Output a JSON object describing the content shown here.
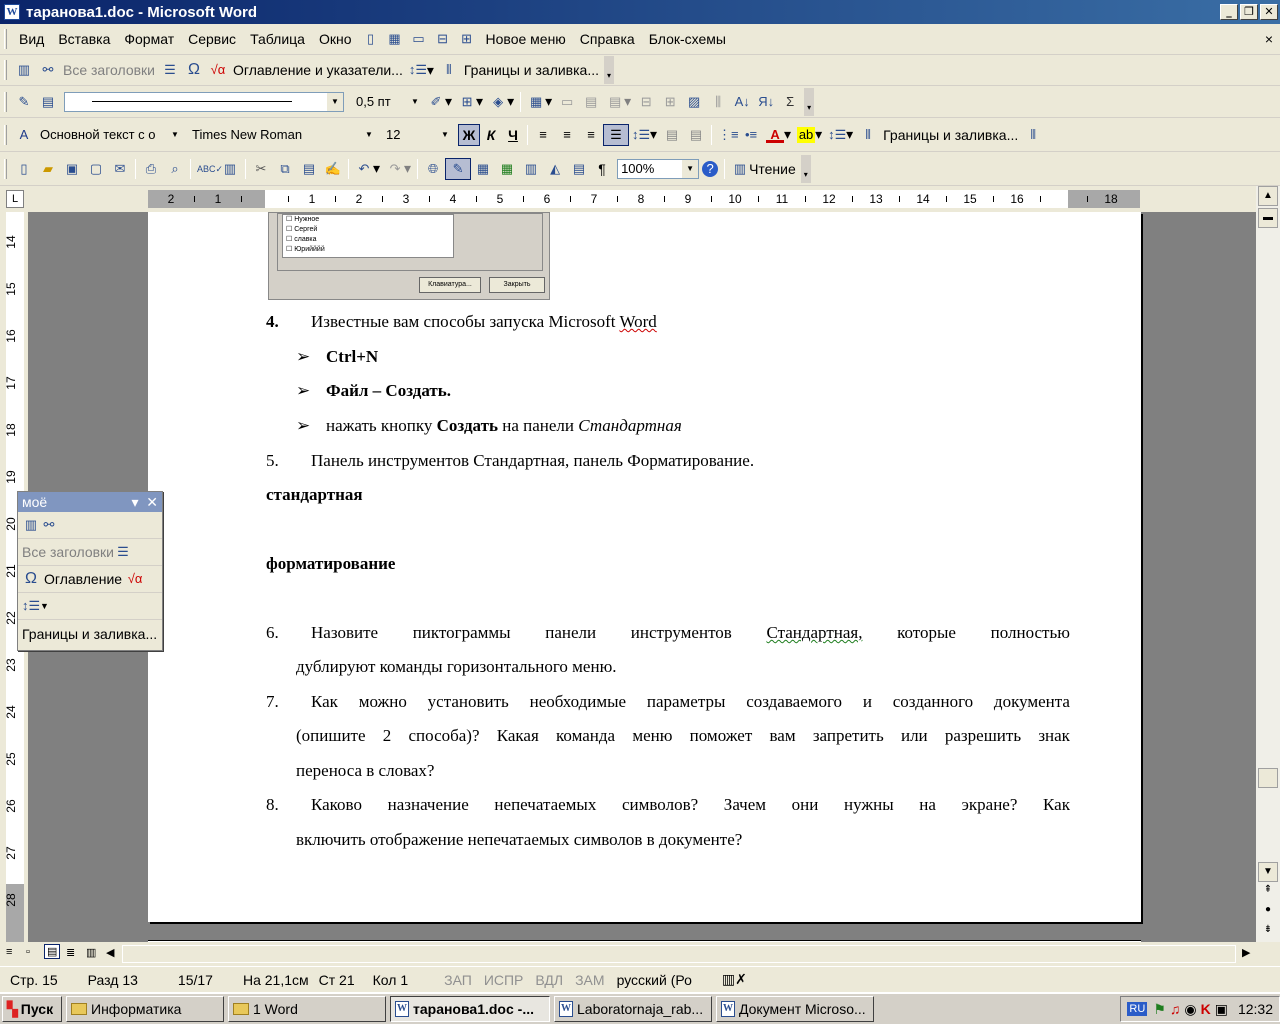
{
  "window": {
    "title": "таранова1.doc - Microsoft Word",
    "icon_letter": "W",
    "minimize": "_",
    "restore": "❐",
    "close": "✕",
    "doc_close": "×"
  },
  "menu": {
    "items": [
      "Вид",
      "Вставка",
      "Формат",
      "Сервис",
      "Таблица",
      "Окно",
      "Новое меню",
      "Справка",
      "Блок-схемы"
    ]
  },
  "toolbar1": {
    "all_headings": "Все заголовки",
    "toc": "Оглавление и указатели...",
    "borders": "Границы и заливка..."
  },
  "toolbar2": {
    "line_weight": "0,5 пт"
  },
  "format_bar": {
    "style": "Основной текст с о",
    "font": "Times New Roman",
    "size": "12",
    "bold": "Ж",
    "italic": "К",
    "underline": "Ч",
    "font_color_letter": "A",
    "borders": "Границы и заливка..."
  },
  "standard_bar": {
    "zoom": "100%",
    "reading": "Чтение",
    "pilcrow": "¶"
  },
  "ruler": {
    "labels": [
      "2",
      "1",
      "1",
      "2",
      "3",
      "4",
      "5",
      "6",
      "7",
      "8",
      "9",
      "10",
      "11",
      "12",
      "13",
      "14",
      "15",
      "16",
      "18"
    ]
  },
  "vruler": {
    "labels": [
      "14",
      "15",
      "16",
      "17",
      "18",
      "19",
      "20",
      "21",
      "22",
      "23",
      "24",
      "25",
      "26",
      "27",
      "28"
    ]
  },
  "embedded_dialog": {
    "list": [
      "Нужное",
      "Сергей",
      "славка",
      "Юрийййй"
    ],
    "btn_keyboard": "Клавиатура...",
    "btn_close": "Закрыть"
  },
  "document": {
    "item4_num": "4.",
    "item4_text_a": "Известные вам способы запуска Microsoft ",
    "item4_text_b": "Word",
    "bullet1": "Ctrl+N",
    "bullet2": "Файл – Создать.",
    "bullet3_a": "нажать кнопку ",
    "bullet3_b": "Создать",
    "bullet3_c": " на панели ",
    "bullet3_d": "Стандартная",
    "item5_num": "5.",
    "item5_text": "Панель инструментов Стандартная, панель Форматирование.",
    "heading_std": "стандартная",
    "heading_fmt": "форматирование",
    "item6_num": "6.",
    "item6_line1": [
      "Назовите",
      "пиктограммы",
      "панели",
      "инструментов",
      "Стандартная,",
      "которые",
      "полностью"
    ],
    "item6_line2": "дублируют команды горизонтального меню.",
    "item7_num": "7.",
    "item7_line1": [
      "Как",
      "можно",
      "установить",
      "необходимые",
      "параметры",
      "создаваемого",
      "и",
      "созданного",
      "документа"
    ],
    "item7_line2": [
      "(опишите",
      "2",
      "способа)?",
      "Какая",
      "команда",
      "меню",
      "поможет",
      "вам",
      "запретить",
      "или",
      "разрешить",
      "знак"
    ],
    "item7_line3": "переноса в словах?",
    "item8_num": "8.",
    "item8_line1": [
      "Каково",
      "назначение",
      "непечатаемых",
      "символов?",
      "Зачем",
      "они",
      "нужны",
      "на",
      "экране?",
      "Как"
    ],
    "item8_line2": "включить отображение непечатаемых символов в документе?"
  },
  "floating_toolbar": {
    "title": "моё",
    "all_headings": "Все заголовки",
    "toc": "Оглавление",
    "borders": "Границы и заливка..."
  },
  "status": {
    "page": "Стр. 15",
    "section": "Разд 13",
    "pages": "15/17",
    "at": "На 21,1см",
    "line": "Ст 21",
    "col": "Кол 1",
    "rec": "ЗАП",
    "trk": "ИСПР",
    "ext": "ВДЛ",
    "ovr": "ЗАМ",
    "lang": "русский (Ро"
  },
  "taskbar": {
    "start": "Пуск",
    "tasks": [
      "Информатика",
      "1 Word",
      "таранова1.doc -...",
      "Laboratornaja_rab...",
      "Документ Microso..."
    ],
    "lang": "RU",
    "clock": "12:32"
  }
}
